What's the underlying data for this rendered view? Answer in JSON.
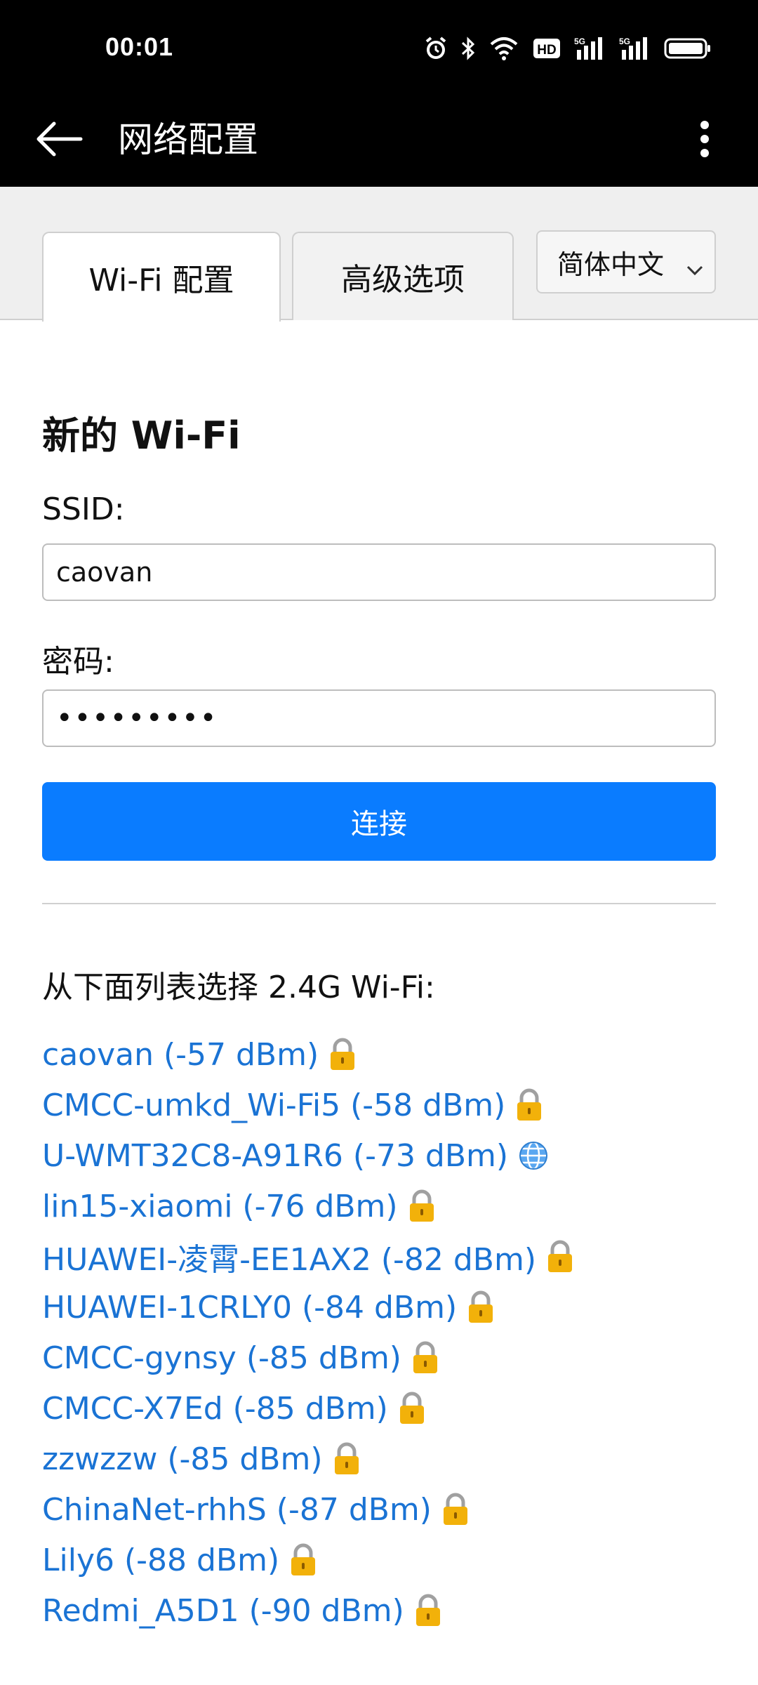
{
  "status_bar": {
    "time": "00:01",
    "icons": [
      "alarm-icon",
      "bluetooth-icon",
      "wifi-signal-icon",
      "hd-icon",
      "signal-5g-icon",
      "signal-5g-icon",
      "battery-icon"
    ],
    "hd_label": "HD",
    "net_label": "5G"
  },
  "app_bar": {
    "title": "网络配置",
    "back_icon": "arrow-left-icon",
    "more_icon": "more-vert-icon"
  },
  "tabs": [
    {
      "label": "Wi-Fi 配置",
      "active": true
    },
    {
      "label": "高级选项",
      "active": false
    }
  ],
  "language_select": {
    "selected": "简体中文"
  },
  "form": {
    "section_title": "新的 Wi-Fi",
    "ssid_label": "SSID:",
    "ssid_value": "caovan",
    "password_label": "密码:",
    "password_value": "•••••••••",
    "connect_label": "连接"
  },
  "list": {
    "heading": "从下面列表选择 2.4G Wi-Fi:",
    "items": [
      {
        "label": "caovan (-57 dBm)",
        "icon": "lock-icon"
      },
      {
        "label": "CMCC-umkd_Wi-Fi5 (-58 dBm)",
        "icon": "lock-icon"
      },
      {
        "label": "U-WMT32C8-A91R6 (-73 dBm)",
        "icon": "globe-icon"
      },
      {
        "label": "lin15-xiaomi (-76 dBm)",
        "icon": "lock-icon"
      },
      {
        "label": "HUAWEI-凌霄-EE1AX2 (-82 dBm)",
        "icon": "lock-icon"
      },
      {
        "label": "HUAWEI-1CRLY0 (-84 dBm)",
        "icon": "lock-icon"
      },
      {
        "label": "CMCC-gynsy (-85 dBm)",
        "icon": "lock-icon"
      },
      {
        "label": "CMCC-X7Ed (-85 dBm)",
        "icon": "lock-icon"
      },
      {
        "label": "zzwzzw (-85 dBm)",
        "icon": "lock-icon"
      },
      {
        "label": "ChinaNet-rhhS (-87 dBm)",
        "icon": "lock-icon"
      },
      {
        "label": "Lily6 (-88 dBm)",
        "icon": "lock-icon"
      },
      {
        "label": "Redmi_A5D1 (-90 dBm)",
        "icon": "lock-icon"
      }
    ]
  },
  "colors": {
    "link": "#1a73d4",
    "button": "#0a7cff",
    "bar": "#000000",
    "lock": "#f2b10a"
  }
}
